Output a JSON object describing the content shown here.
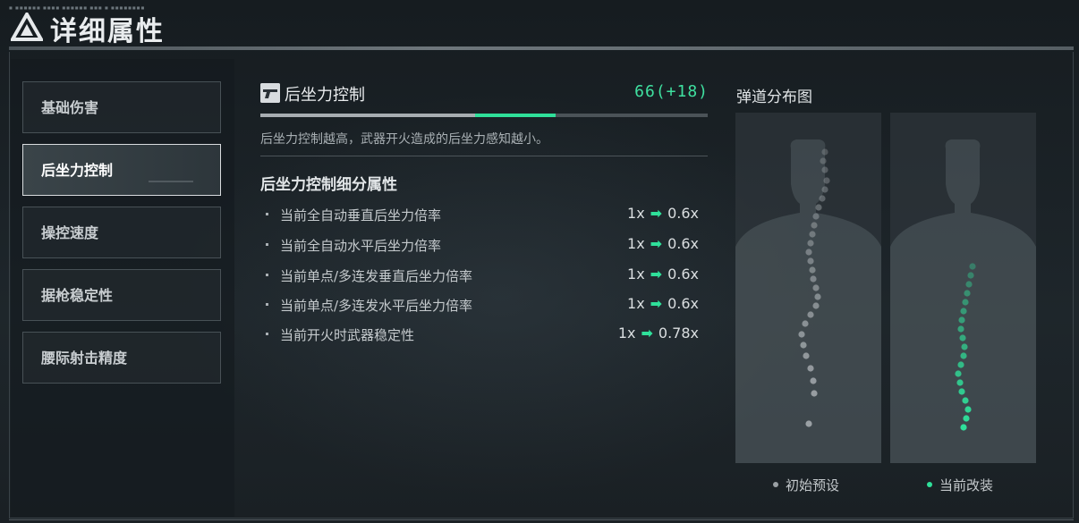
{
  "header": {
    "title": "详细属性",
    "tiny_text": "■ ■■■■■■ ■■■■ ■■■■■■ ■■■ ■ ■■■■■■■■",
    "logo_icon": "triangle-a-logo-icon"
  },
  "sidebar": {
    "items": [
      {
        "label": "基础伤害",
        "active": false
      },
      {
        "label": "后坐力控制",
        "active": true
      },
      {
        "label": "操控速度",
        "active": false
      },
      {
        "label": "据枪稳定性",
        "active": false
      },
      {
        "label": "腰际射击精度",
        "active": false
      }
    ]
  },
  "stat": {
    "icon": "pistol-icon",
    "name": "后坐力控制",
    "value": "66(+18)",
    "base_fraction": 0.48,
    "bonus_fraction": 0.18,
    "description": "后坐力控制越高，武器开火造成的后坐力感知越小。"
  },
  "detail": {
    "title": "后坐力控制细分属性",
    "rows": [
      {
        "label": "当前全自动垂直后坐力倍率",
        "from": "1x",
        "to": "0.6x"
      },
      {
        "label": "当前全自动水平后坐力倍率",
        "from": "1x",
        "to": "0.6x"
      },
      {
        "label": "当前单点/多连发垂直后坐力倍率",
        "from": "1x",
        "to": "0.6x"
      },
      {
        "label": "当前单点/多连发水平后坐力倍率",
        "from": "1x",
        "to": "0.6x"
      },
      {
        "label": "当前开火时武器稳定性",
        "from": "1x",
        "to": "0.78x"
      }
    ],
    "arrow_icon": "right-arrow-icon"
  },
  "ballistic": {
    "title": "弹道分布图",
    "legend": [
      {
        "label": "初始预设",
        "color": "#9aa0a4"
      },
      {
        "label": "当前改装",
        "color": "#2fe09a"
      }
    ]
  },
  "colors": {
    "accent": "#2fe09a",
    "base": "#a7adb1"
  }
}
